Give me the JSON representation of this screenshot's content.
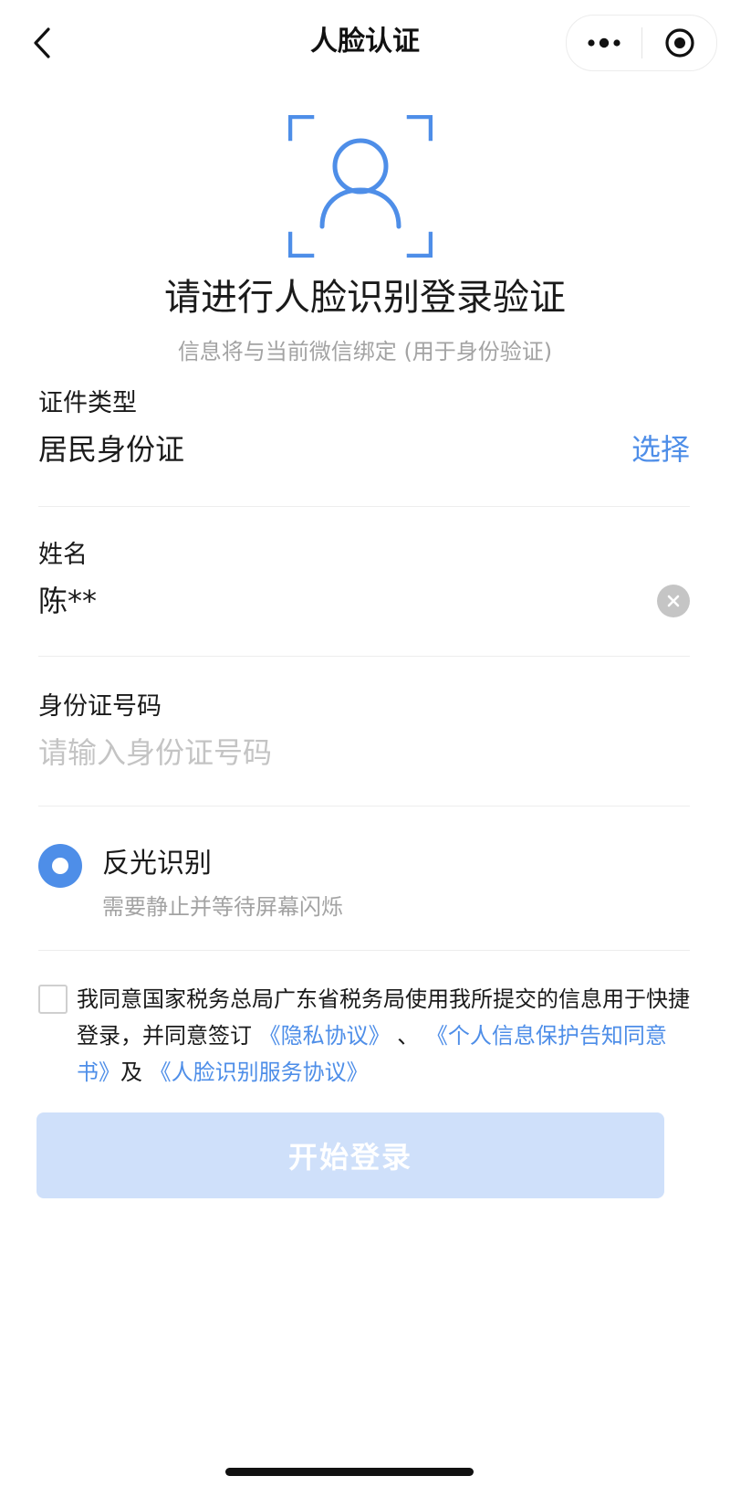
{
  "navbar": {
    "title": "人脸认证",
    "back_icon": "chevron-left-icon",
    "more_icon": "more-dots-icon",
    "close_icon": "target-circle-icon"
  },
  "hero": {
    "icon": "face-scan-icon",
    "accent_color": "#4E8EE8",
    "title": "请进行人脸识别登录验证",
    "subtitle": "信息将与当前微信绑定 (用于身份验证)"
  },
  "form": {
    "id_type": {
      "label": "证件类型",
      "value": "居民身份证",
      "action": "选择"
    },
    "name": {
      "label": "姓名",
      "value": "陈**",
      "clear_icon": "clear-x-icon"
    },
    "id_number": {
      "label": "身份证号码",
      "placeholder": "请输入身份证号码",
      "value": ""
    }
  },
  "option": {
    "title": "反光识别",
    "subtitle": "需要静止并等待屏幕闪烁",
    "selected": true
  },
  "agreement": {
    "checked": false,
    "text_1": "我同意国家税务总局广东省税务局使用我所提交的信息用于快捷登录，并同意签订",
    "link_1": "《隐私协议》",
    "sep_1": "、",
    "link_2": "《个人信息保护告知同意书》",
    "sep_2": "及",
    "link_3": "《人脸识别服务协议》"
  },
  "submit": {
    "label": "开始登录",
    "enabled": false
  }
}
